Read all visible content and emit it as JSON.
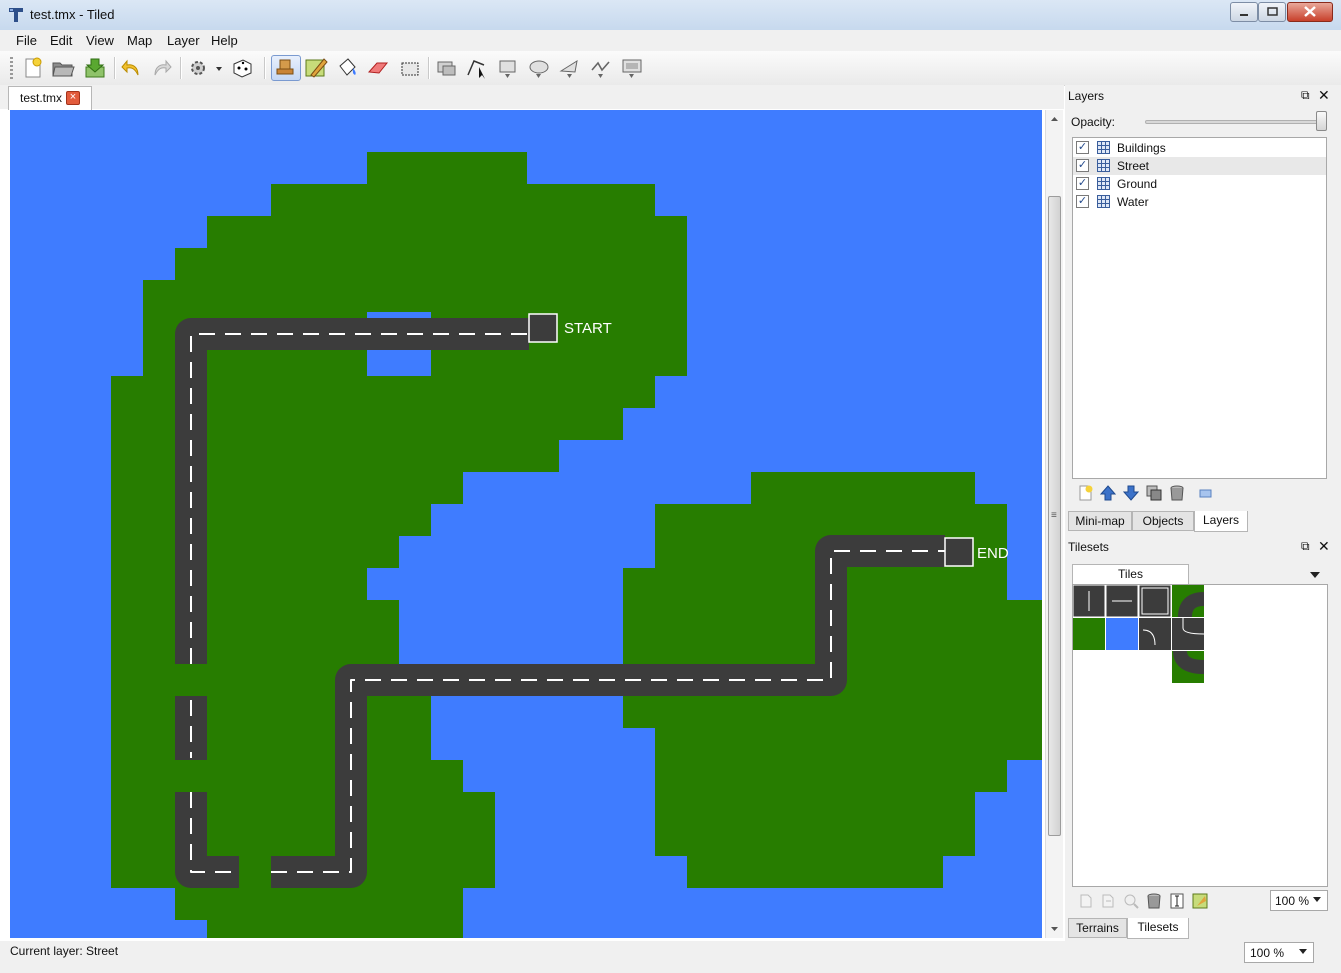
{
  "window": {
    "title": "test.tmx - Tiled"
  },
  "menu": {
    "items": [
      "File",
      "Edit",
      "View",
      "Map",
      "Layer",
      "Help"
    ]
  },
  "document": {
    "tab_label": "test.tmx"
  },
  "map": {
    "labels": {
      "start": "START",
      "end": "END"
    },
    "colors": {
      "water": "#3f7cff",
      "ground": "#277d00",
      "road": "#3c3c3c",
      "road_marking": "#ffffff"
    }
  },
  "layers_panel": {
    "title": "Layers",
    "opacity_label": "Opacity:",
    "opacity": 1.0,
    "layers": [
      {
        "name": "Buildings",
        "visible": true,
        "selected": false
      },
      {
        "name": "Street",
        "visible": true,
        "selected": true
      },
      {
        "name": "Ground",
        "visible": true,
        "selected": false
      },
      {
        "name": "Water",
        "visible": true,
        "selected": false
      }
    ],
    "tabs": [
      "Mini-map",
      "Objects",
      "Layers"
    ],
    "active_tab": "Layers"
  },
  "tilesets_panel": {
    "title": "Tilesets",
    "tileset_tab": "Tiles",
    "zoom": "100 %",
    "tabs": [
      "Terrains",
      "Tilesets"
    ],
    "active_tab": "Tilesets"
  },
  "status": {
    "current_layer": "Current layer: Street",
    "zoom": "100 %"
  }
}
